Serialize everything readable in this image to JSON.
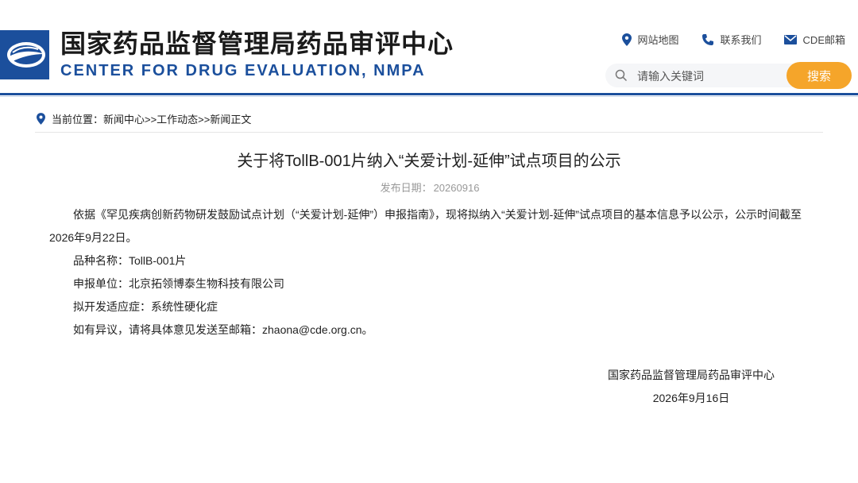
{
  "header": {
    "title_cn": "国家药品监督管理局药品审评中心",
    "title_en": "CENTER FOR DRUG EVALUATION, NMPA",
    "links": [
      {
        "label": "网站地图",
        "icon": "location-pin-icon"
      },
      {
        "label": "联系我们",
        "icon": "phone-icon"
      },
      {
        "label": "CDE邮箱",
        "icon": "mail-icon"
      }
    ],
    "search": {
      "placeholder": "请输入关键词",
      "button_label": "搜索"
    },
    "colors": {
      "brand_blue": "#1b4f9c",
      "search_orange": "#f5a52a"
    }
  },
  "breadcrumb": {
    "text": "当前位置：新闻中心>>工作动态>>新闻正文"
  },
  "article": {
    "title": "关于将TollB-001片纳入“关爱计划-延伸”试点项目的公示",
    "pub_label": "发布日期：",
    "pub_date": "20260916",
    "para1": "依据《罕见疾病创新药物研发鼓励试点计划（“关爱计划-延伸”）申报指南》，现将拟纳入“关爱计划-延伸”试点项目的基本信息予以公示，公示时间截至2026年9月22日。",
    "line_product": "品种名称：TollB-001片",
    "line_applicant": "申报单位：北京拓领博泰生物科技有限公司",
    "line_indication": "拟开发适应症：系统性硬化症",
    "line_contact": "如有异议，请将具体意见发送至邮箱：zhaona@cde.org.cn。",
    "sign_org": "国家药品监督管理局药品审评中心",
    "sign_date": "2026年9月16日"
  }
}
